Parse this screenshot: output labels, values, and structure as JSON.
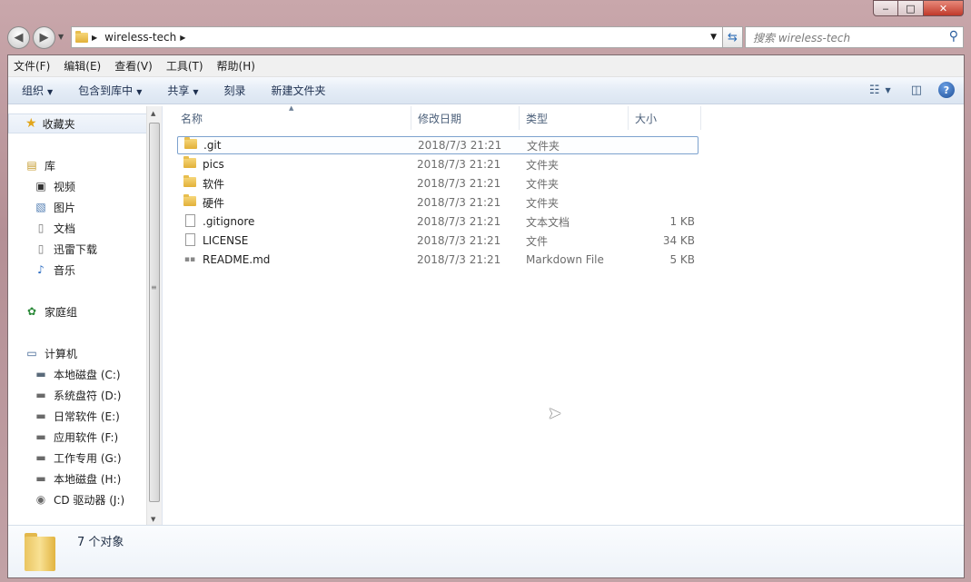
{
  "window": {
    "minimize_glyph": "‒",
    "maximize_glyph": "□",
    "close_glyph": "✕"
  },
  "navbar": {
    "back_glyph": "◀",
    "forward_glyph": "▶",
    "address_crumb": "wireless-tech",
    "search_placeholder": "搜索 wireless-tech"
  },
  "menubar": {
    "items": [
      "文件(F)",
      "编辑(E)",
      "查看(V)",
      "工具(T)",
      "帮助(H)"
    ]
  },
  "toolbar": {
    "organize": "组织",
    "include_library": "包含到库中",
    "share": "共享",
    "burn": "刻录",
    "new_folder": "新建文件夹"
  },
  "navpane": {
    "favorites": "收藏夹",
    "libraries": "库",
    "library_items": [
      "视频",
      "图片",
      "文档",
      "迅雷下载",
      "音乐"
    ],
    "homegroup": "家庭组",
    "computer": "计算机",
    "drives": [
      "本地磁盘 (C:)",
      "系统盘符 (D:)",
      "日常软件 (E:)",
      "应用软件 (F:)",
      "工作专用 (G:)",
      "本地磁盘 (H:)",
      "CD 驱动器 (J:)"
    ]
  },
  "columns": {
    "name": "名称",
    "date": "修改日期",
    "type": "类型",
    "size": "大小"
  },
  "files": [
    {
      "name": ".git",
      "date": "2018/7/3 21:21",
      "type": "文件夹",
      "size": "",
      "kind": "folder"
    },
    {
      "name": "pics",
      "date": "2018/7/3 21:21",
      "type": "文件夹",
      "size": "",
      "kind": "folder"
    },
    {
      "name": "软件",
      "date": "2018/7/3 21:21",
      "type": "文件夹",
      "size": "",
      "kind": "folder"
    },
    {
      "name": "硬件",
      "date": "2018/7/3 21:21",
      "type": "文件夹",
      "size": "",
      "kind": "folder"
    },
    {
      "name": ".gitignore",
      "date": "2018/7/3 21:21",
      "type": "文本文档",
      "size": "1 KB",
      "kind": "text"
    },
    {
      "name": "LICENSE",
      "date": "2018/7/3 21:21",
      "type": "文件",
      "size": "34 KB",
      "kind": "file"
    },
    {
      "name": "README.md",
      "date": "2018/7/3 21:21",
      "type": "Markdown File",
      "size": "5 KB",
      "kind": "md"
    }
  ],
  "status": {
    "count_text": "7 个对象"
  }
}
